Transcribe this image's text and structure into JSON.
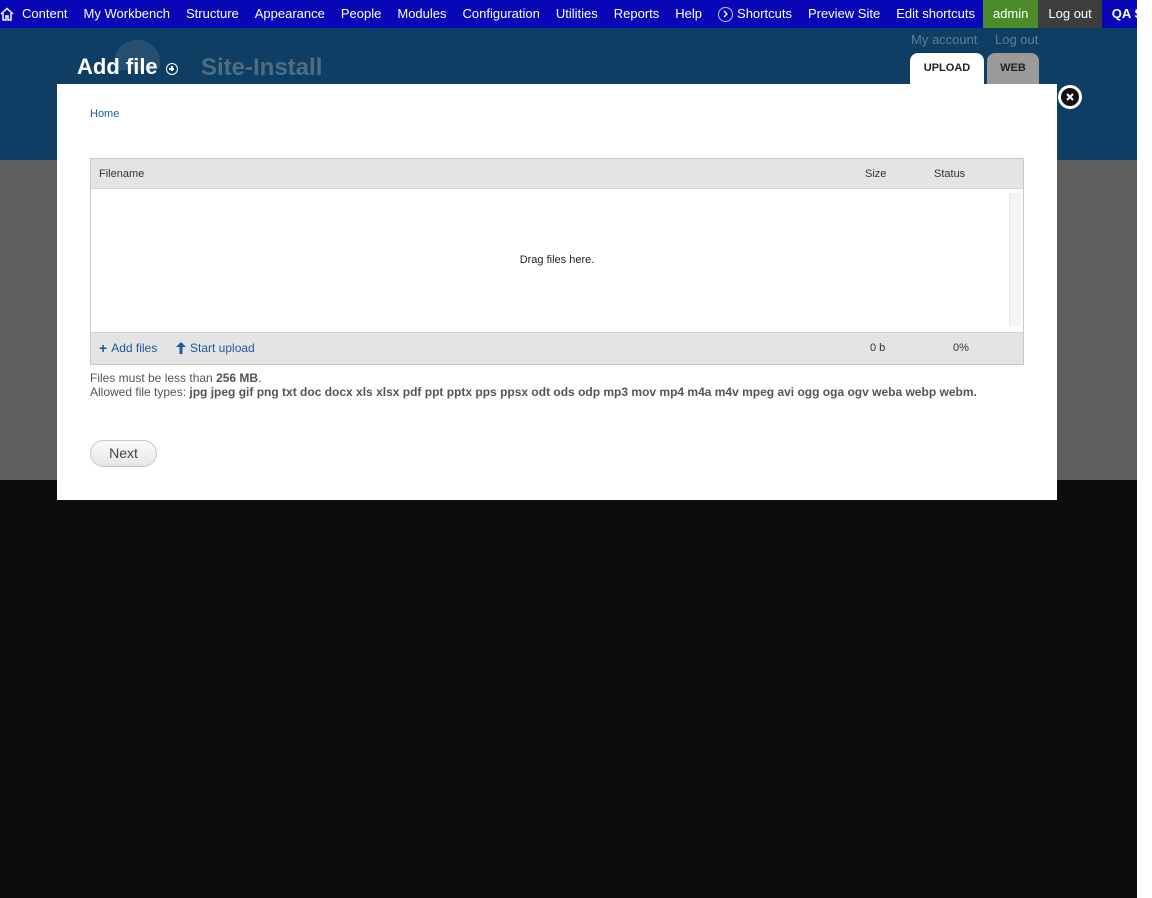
{
  "toolbar": {
    "items": [
      "Content",
      "My Workbench",
      "Structure",
      "Appearance",
      "People",
      "Modules",
      "Configuration",
      "Utilities",
      "Reports",
      "Help"
    ],
    "shortcuts_label": "Shortcuts",
    "preview_site": "Preview Site",
    "edit_shortcuts": "Edit shortcuts",
    "user": "admin",
    "logout": "Log out",
    "server": "QA SERVER"
  },
  "header": {
    "title": "Add file",
    "site_name": "Site-Install",
    "my_account": "My account",
    "log_out": "Log out",
    "tabs": [
      "UPLOAD",
      "WEB"
    ]
  },
  "dialog": {
    "breadcrumb": "Home",
    "uploader": {
      "col_filename": "Filename",
      "col_size": "Size",
      "col_status": "Status",
      "drag_text": "Drag files here.",
      "add_files": "Add files",
      "start_upload": "Start upload",
      "total_size": "0 b",
      "total_status": "0%"
    },
    "size_limit_prefix": "Files must be less than ",
    "size_limit_value": "256 MB",
    "size_limit_suffix": ".",
    "allowed_prefix": "Allowed file types: ",
    "allowed_types": "jpg jpeg gif png txt doc docx xls xlsx pdf ppt pptx pps ppsx odt ods odp mp3 mov mp4 m4a m4v mpeg avi ogg oga ogv weba webp webm.",
    "next_button": "Next"
  },
  "colors": {
    "toolbar": "#0707b8",
    "header": "#0e3e63",
    "link": "#1a5a96",
    "admin_bg": "#4a8c2a"
  }
}
